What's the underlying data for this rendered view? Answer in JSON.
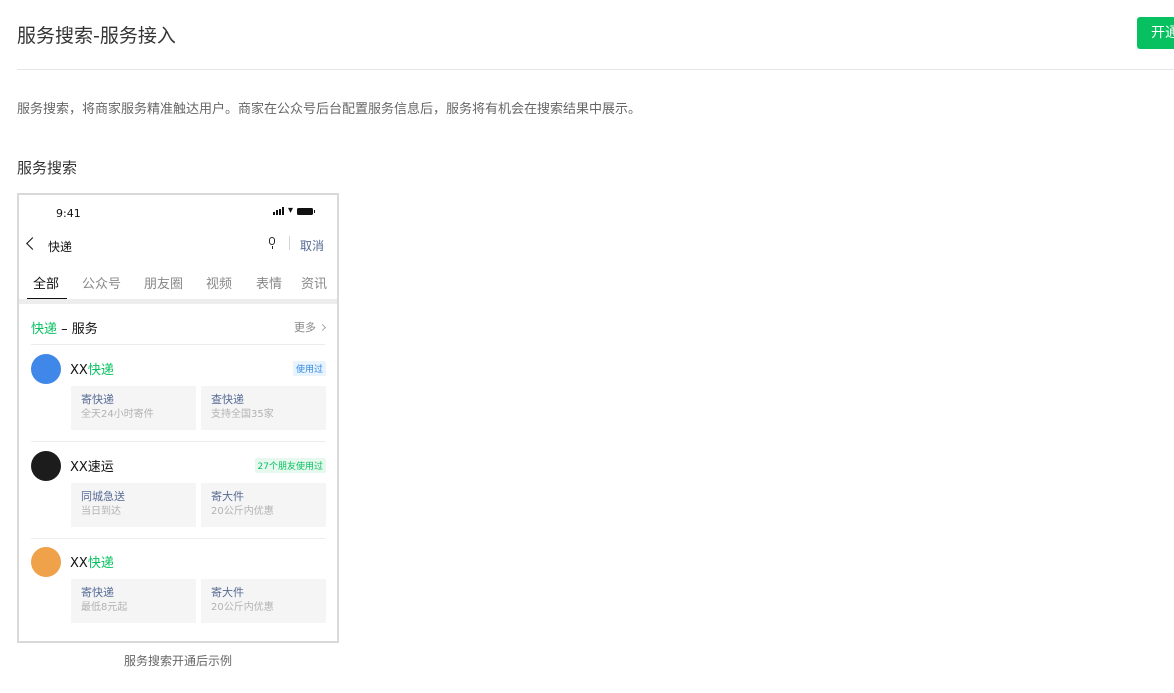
{
  "header": {
    "title": "服务搜索-服务接入",
    "primary_button_label": "开通"
  },
  "description": "服务搜索，将商家服务精准触达用户。商家在公众号后台配置服务信息后，服务将有机会在搜索结果中展示。",
  "section_title": "服务搜索",
  "preview": {
    "status_time": "9:41",
    "search_query": "快递",
    "cancel_label": "取消",
    "tabs": [
      "全部",
      "公众号",
      "朋友圈",
      "视频",
      "表情",
      "资讯"
    ],
    "active_tab": "全部",
    "service_header": {
      "keyword": "快递",
      "rest": " – 服务"
    },
    "more_label": "更多",
    "items": [
      {
        "name_prefix": "XX",
        "name_keyword": "快递",
        "avatar_color": "#3f87e8",
        "tag": "使用过",
        "cards": [
          {
            "title": "寄快递",
            "subtitle": "全天24小时寄件"
          },
          {
            "title": "查快递",
            "subtitle": "支持全国35家"
          }
        ]
      },
      {
        "name_prefix": "XX速运",
        "name_keyword": "",
        "avatar_color": "#1c1c1c",
        "tag": "27个朋友使用过",
        "cards": [
          {
            "title": "同城急送",
            "subtitle": "当日到达"
          },
          {
            "title": "寄大件",
            "subtitle": "20公斤内优惠"
          }
        ]
      },
      {
        "name_prefix": "XX",
        "name_keyword": "快递",
        "avatar_color": "#f0a24a",
        "tag": "",
        "cards": [
          {
            "title": "寄快递",
            "subtitle": "最低8元起"
          },
          {
            "title": "寄大件",
            "subtitle": "20公斤内优惠"
          }
        ]
      }
    ]
  },
  "caption": "服务搜索开通后示例",
  "colors": {
    "brand_green": "#07c160",
    "link_blue": "#576b95"
  }
}
